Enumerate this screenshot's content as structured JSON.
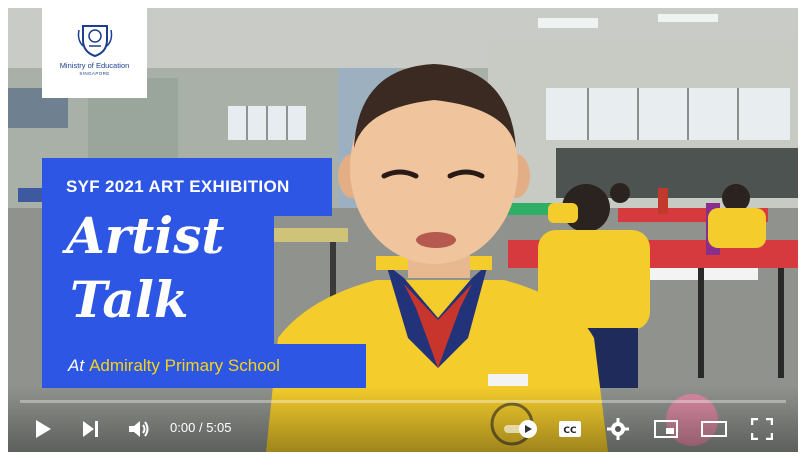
{
  "logo": {
    "name": "Ministry of Education",
    "sub": "SINGAPORE"
  },
  "title_card": {
    "heading": "SYF 2021 ART EXHIBITION",
    "line1": "Artist",
    "line2": "Talk",
    "prefix": "At",
    "school": "Admiralty Primary School"
  },
  "player": {
    "time_current": "0:00",
    "time_separator": "/",
    "time_total": "5:05",
    "progress": 0,
    "accent_color": "#ff0000"
  },
  "icons": [
    "play-icon",
    "next-icon",
    "volume-icon",
    "autoplay-toggle-icon",
    "captions-icon",
    "settings-icon",
    "miniplayer-icon",
    "theater-icon",
    "fullscreen-icon"
  ],
  "colors": {
    "title_blue": "#2c56e3",
    "school_yellow": "#f6d31c",
    "uniform_yellow": "#f4cc2c"
  }
}
